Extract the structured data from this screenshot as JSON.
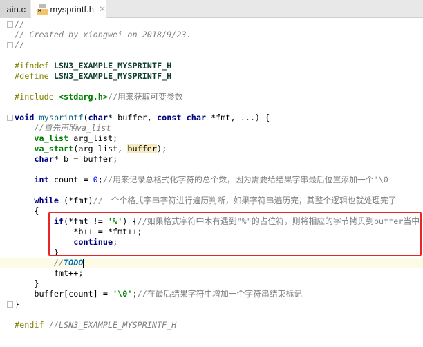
{
  "tabs": [
    {
      "label": "ain.c",
      "close": "✕",
      "active": false
    },
    {
      "label": "mysprintf.h",
      "close": "✕",
      "active": true,
      "icon": "header-file-icon",
      "icon_letter": "H"
    }
  ],
  "code": [
    [
      {
        "t": "//",
        "k": "c"
      }
    ],
    [
      {
        "t": "// Created by xiongwei on 2018/9/23.",
        "k": "c"
      }
    ],
    [
      {
        "t": "//",
        "k": "c"
      }
    ],
    [],
    [
      {
        "t": "#ifndef ",
        "k": "p"
      },
      {
        "t": "LSN3_EXAMPLE_MYSPRINTF_H",
        "k": "m"
      }
    ],
    [
      {
        "t": "#define ",
        "k": "p"
      },
      {
        "t": "LSN3_EXAMPLE_MYSPRINTF_H",
        "k": "m"
      }
    ],
    [],
    [
      {
        "t": "#include ",
        "k": "p"
      },
      {
        "t": "<stdarg.h>",
        "k": "s"
      },
      {
        "t": "//用来获取可变参数",
        "k": "cc"
      }
    ],
    [],
    [
      {
        "t": "void ",
        "k": "k"
      },
      {
        "t": "mysprintf",
        "k": "fn"
      },
      {
        "t": "(",
        "k": ""
      },
      {
        "t": "char",
        "k": "k"
      },
      {
        "t": "* buffer, ",
        "k": ""
      },
      {
        "t": "const char ",
        "k": "k"
      },
      {
        "t": "*fmt, ...) {",
        "k": ""
      }
    ],
    [
      {
        "t": "    ",
        "k": ""
      },
      {
        "t": "//首先声明va_list",
        "k": "c"
      }
    ],
    [
      {
        "t": "    ",
        "k": ""
      },
      {
        "t": "va_list",
        "k": "mac"
      },
      {
        "t": " arg_list;",
        "k": ""
      }
    ],
    [
      {
        "t": "    ",
        "k": ""
      },
      {
        "t": "va_start",
        "k": "mac"
      },
      {
        "t": "(arg_list, ",
        "k": ""
      },
      {
        "t": "buffer",
        "k": "hl"
      },
      {
        "t": ");",
        "k": ""
      }
    ],
    [
      {
        "t": "    ",
        "k": ""
      },
      {
        "t": "char",
        "k": "k"
      },
      {
        "t": "* b = buffer;",
        "k": ""
      }
    ],
    [],
    [
      {
        "t": "    ",
        "k": ""
      },
      {
        "t": "int",
        "k": "k"
      },
      {
        "t": " count = ",
        "k": ""
      },
      {
        "t": "0",
        "k": "n"
      },
      {
        "t": ";",
        "k": ""
      },
      {
        "t": "//用来记录总格式化字符的总个数，因为需要给结果字串最后位置添加一个'\\0'",
        "k": "cc"
      }
    ],
    [],
    [
      {
        "t": "    ",
        "k": ""
      },
      {
        "t": "while",
        "k": "k"
      },
      {
        "t": " (*fmt)",
        "k": ""
      },
      {
        "t": "//一个个格式字串字符进行遍历判断，如果字符串遍历完，其整个逻辑也就处理完了",
        "k": "cc"
      }
    ],
    [
      {
        "t": "    {",
        "k": ""
      }
    ],
    [
      {
        "t": "        ",
        "k": ""
      },
      {
        "t": "if",
        "k": "k"
      },
      {
        "t": "(*fmt != ",
        "k": ""
      },
      {
        "t": "'%'",
        "k": "s"
      },
      {
        "t": ") {",
        "k": ""
      },
      {
        "t": "//如果格式字符中木有遇到\"%\"的占位符，则将相应的字节拷贝到buffer当中",
        "k": "cc"
      }
    ],
    [
      {
        "t": "            *b++ = *fmt++;",
        "k": ""
      }
    ],
    [
      {
        "t": "            ",
        "k": ""
      },
      {
        "t": "continue",
        "k": "k"
      },
      {
        "t": ";",
        "k": ""
      }
    ],
    [
      {
        "t": "        }",
        "k": ""
      }
    ],
    [
      {
        "t": "        ",
        "k": ""
      },
      {
        "t": "//",
        "k": "c"
      },
      {
        "t": "TODO",
        "k": "todo"
      }
    ],
    [
      {
        "t": "        fmt++;",
        "k": ""
      }
    ],
    [
      {
        "t": "    }",
        "k": ""
      }
    ],
    [
      {
        "t": "    buffer[count] = ",
        "k": ""
      },
      {
        "t": "'\\0'",
        "k": "s"
      },
      {
        "t": ";",
        "k": ""
      },
      {
        "t": "//在最后结果字符中增加一个字符串结束标记",
        "k": "cc"
      }
    ],
    [
      {
        "t": "}",
        "k": ""
      }
    ],
    [],
    [
      {
        "t": "#endif ",
        "k": "p"
      },
      {
        "t": "//LSN3_EXAMPLE_MYSPRINTF_H",
        "k": "c"
      }
    ]
  ]
}
